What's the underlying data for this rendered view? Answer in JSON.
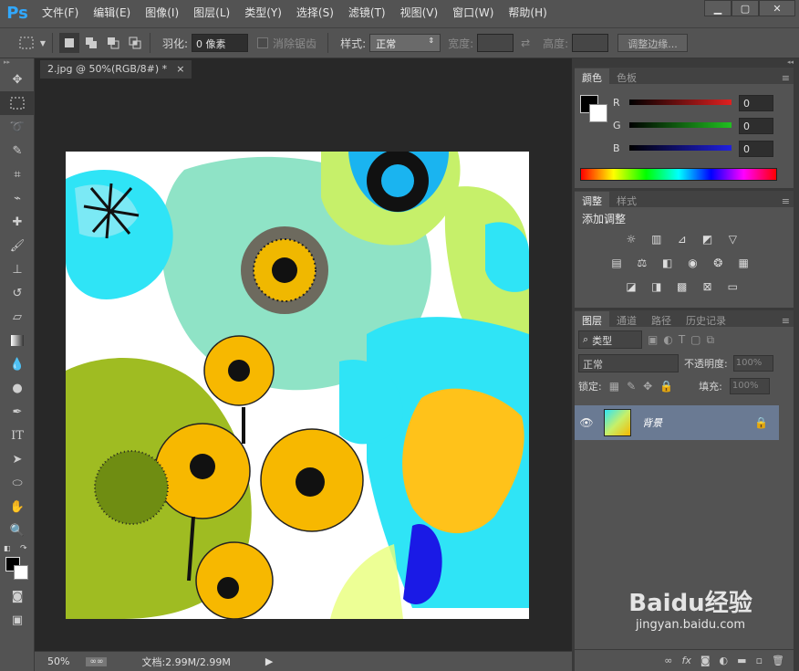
{
  "app": {
    "logo": "Ps"
  },
  "menu": [
    "文件(F)",
    "编辑(E)",
    "图像(I)",
    "图层(L)",
    "类型(Y)",
    "选择(S)",
    "滤镜(T)",
    "视图(V)",
    "窗口(W)",
    "帮助(H)"
  ],
  "window_controls": {
    "minimize": "▁",
    "restore": "▢",
    "close": "✕"
  },
  "options": {
    "feather_label": "羽化:",
    "feather_value": "0 像素",
    "antialias_label": "消除锯齿",
    "style_label": "样式:",
    "style_value": "正常",
    "width_label": "宽度:",
    "height_label": "高度:",
    "refine_button": "调整边缘..."
  },
  "document": {
    "tab_title": "2.jpg @ 50%(RGB/8#) *",
    "tab_close": "×",
    "zoom": "50%",
    "doc_info": "文档:2.99M/2.99M"
  },
  "color_panel": {
    "tabs": [
      "颜色",
      "色板"
    ],
    "channels": [
      {
        "name": "R",
        "value": "0",
        "color": "#e02020"
      },
      {
        "name": "G",
        "value": "0",
        "color": "#20c020"
      },
      {
        "name": "B",
        "value": "0",
        "color": "#2020e0"
      }
    ]
  },
  "adjust_panel": {
    "tabs": [
      "调整",
      "样式"
    ],
    "title": "添加调整"
  },
  "layers_panel": {
    "tabs": [
      "图层",
      "通道",
      "路径",
      "历史记录"
    ],
    "filter_kind": "类型",
    "blend_mode": "正常",
    "opacity_label": "不透明度:",
    "opacity_value": "100%",
    "lock_label": "锁定:",
    "fill_label": "填充:",
    "fill_value": "100%",
    "layer_name": "背景"
  },
  "watermark": {
    "brand": "Baidu经验",
    "url": "jingyan.baidu.com"
  }
}
